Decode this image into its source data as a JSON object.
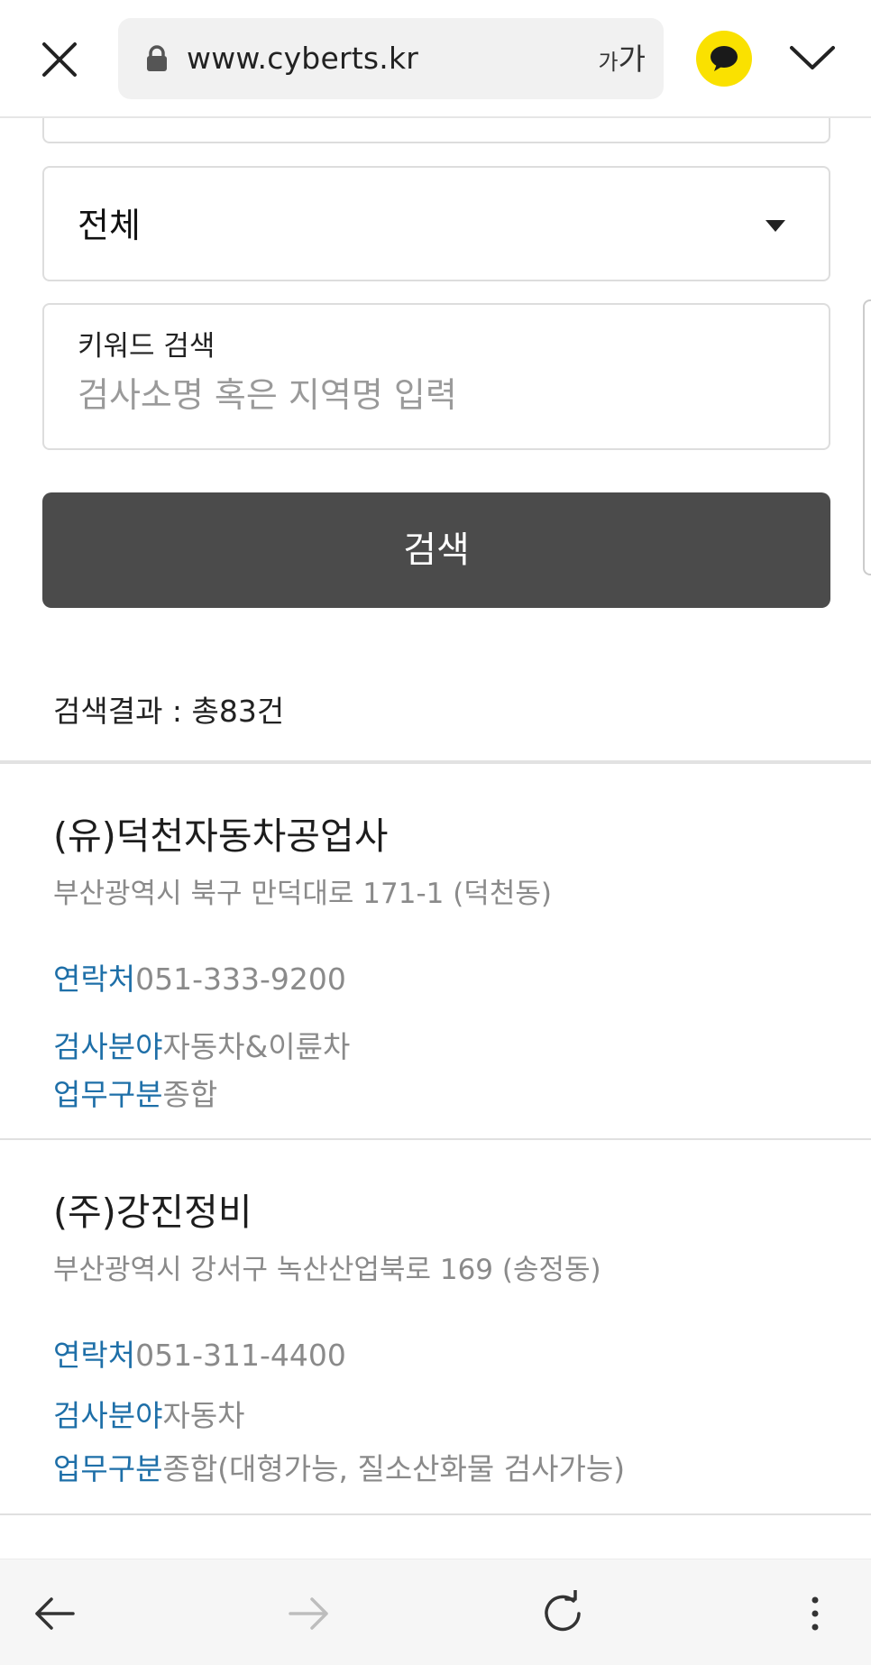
{
  "browser": {
    "url": "www.cyberts.kr",
    "text_size_small": "가",
    "text_size_large": "가",
    "icons": {
      "close": "close-icon",
      "lock": "lock-icon",
      "talk": "chat-bubble-icon",
      "menu": "chevron-down-icon"
    }
  },
  "search_form": {
    "category_select": {
      "value": "전체"
    },
    "keyword": {
      "label": "키워드 검색",
      "value": "",
      "placeholder": "검사소명 혹은 지역명 입력"
    },
    "search_button_label": "검색"
  },
  "results": {
    "summary": "검색결과 : 총83건",
    "items": [
      {
        "name": "(유)덕천자동차공업사",
        "address": "부산광역시 북구 만덕대로 171-1 (덕천동)",
        "contact_label": "연락처",
        "contact_value": "051-333-9200",
        "field_label": "검사분야",
        "field_value": "자동차&이륜차",
        "business_label": "업무구분",
        "business_value": "종합"
      },
      {
        "name": "(주)강진정비",
        "address": "부산광역시 강서구 녹산산업북로 169 (송정동)",
        "contact_label": "연락처",
        "contact_value": "051-311-4400",
        "field_label": "검사분야",
        "field_value": "자동차",
        "business_label": "업무구분",
        "business_value": "종합(대형가능, 질소산화물 검사가능)"
      }
    ]
  },
  "bottom_nav": {
    "icons": [
      "back-arrow-icon",
      "forward-arrow-icon",
      "refresh-icon",
      "more-vertical-icon"
    ]
  },
  "colors": {
    "accent_label": "#1e6fa8",
    "button_dark": "#4b4b4b",
    "talk_yellow": "#fae100"
  }
}
